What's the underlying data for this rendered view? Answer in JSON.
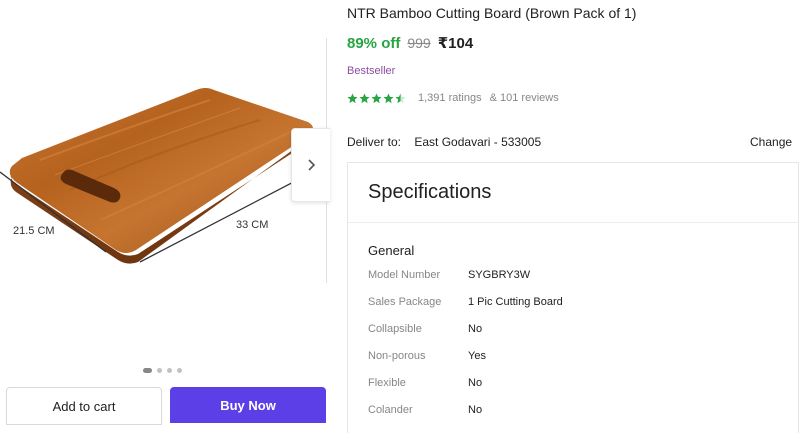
{
  "product": {
    "title": "NTR Bamboo Cutting Board (Brown Pack of 1)",
    "discount": "89% off",
    "mrp": "999",
    "price": "₹104",
    "badge": "Bestseller",
    "rating_stars": 4.5,
    "ratings": "1,391 ratings",
    "reviews": "& 101 reviews"
  },
  "image": {
    "dim_width": "21.5 CM",
    "dim_length": "33 CM",
    "dot_count": 4,
    "active_dot": 1
  },
  "actions": {
    "add_to_cart": "Add to cart",
    "buy_now": "Buy Now"
  },
  "delivery": {
    "label": "Deliver to:",
    "location": "East Godavari - 533005",
    "change": "Change"
  },
  "specs": {
    "title": "Specifications",
    "group": "General",
    "rows": [
      {
        "key": "Model Number",
        "value": "SYGBRY3W"
      },
      {
        "key": "Sales Package",
        "value": "1 Pic Cutting Board"
      },
      {
        "key": "Collapsible",
        "value": "No"
      },
      {
        "key": "Non-porous",
        "value": "Yes"
      },
      {
        "key": "Flexible",
        "value": "No"
      },
      {
        "key": "Colander",
        "value": "No"
      }
    ]
  },
  "colors": {
    "discount": "#26a541",
    "buy_button": "#5d3fe8",
    "stars": "#26a541",
    "badge": "#8a4d9e"
  },
  "icons": [
    "chevron-right-icon",
    "star-icon"
  ]
}
